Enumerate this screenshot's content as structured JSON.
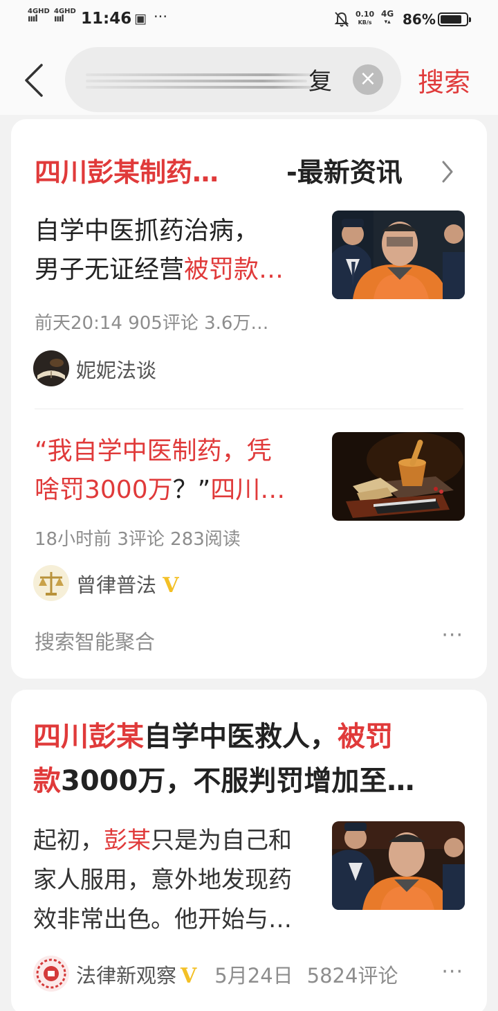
{
  "status_bar": {
    "signal1": "4GHD",
    "signal2": "4GHD",
    "time": "11:46",
    "more": "···",
    "speed_value": "0.10",
    "speed_unit": "KB/s",
    "network": "4G",
    "battery_percent": "86%",
    "battery_level": 0.86
  },
  "header": {
    "query_visible_char": "复",
    "search_label": "搜索"
  },
  "card1": {
    "heading_highlight": "四川彭某制药…",
    "heading_suffix": "-最新资讯",
    "items": [
      {
        "title_line1": "自学中医抓药治病，",
        "title_line2_plain": "男子无证经营",
        "title_line2_red": "被罚款…",
        "meta": "前天20:14  905评论  3.6万…",
        "author": "妮妮法谈"
      },
      {
        "title_line1_red": "“我自学中医制药，凭",
        "title_line2_red1": "啥罚3000万",
        "title_line2_plain": "？”",
        "title_line2_red2": "四川…",
        "meta": "18小时前  3评论  283阅读",
        "author": "曾律普法",
        "verified": "V"
      }
    ],
    "footer_label": "搜索智能聚合",
    "footer_more": "···"
  },
  "card2": {
    "title_red1": "四川彭某",
    "title_plain1": "自学中医救人，",
    "title_red2": "被罚",
    "title_red3": "款",
    "title_plain2": "3000万，不服判罚增加至…",
    "body1_plain": "起初，",
    "body1_red": "彭某",
    "body1_plain2": "只是为自己和",
    "body2": "家人服用，意外地发现药",
    "body3": "效非常出色。他开始与…",
    "author": "法律新观察",
    "verified": "V",
    "date": "5月24日",
    "comments": "5824评论",
    "more": "···"
  }
}
